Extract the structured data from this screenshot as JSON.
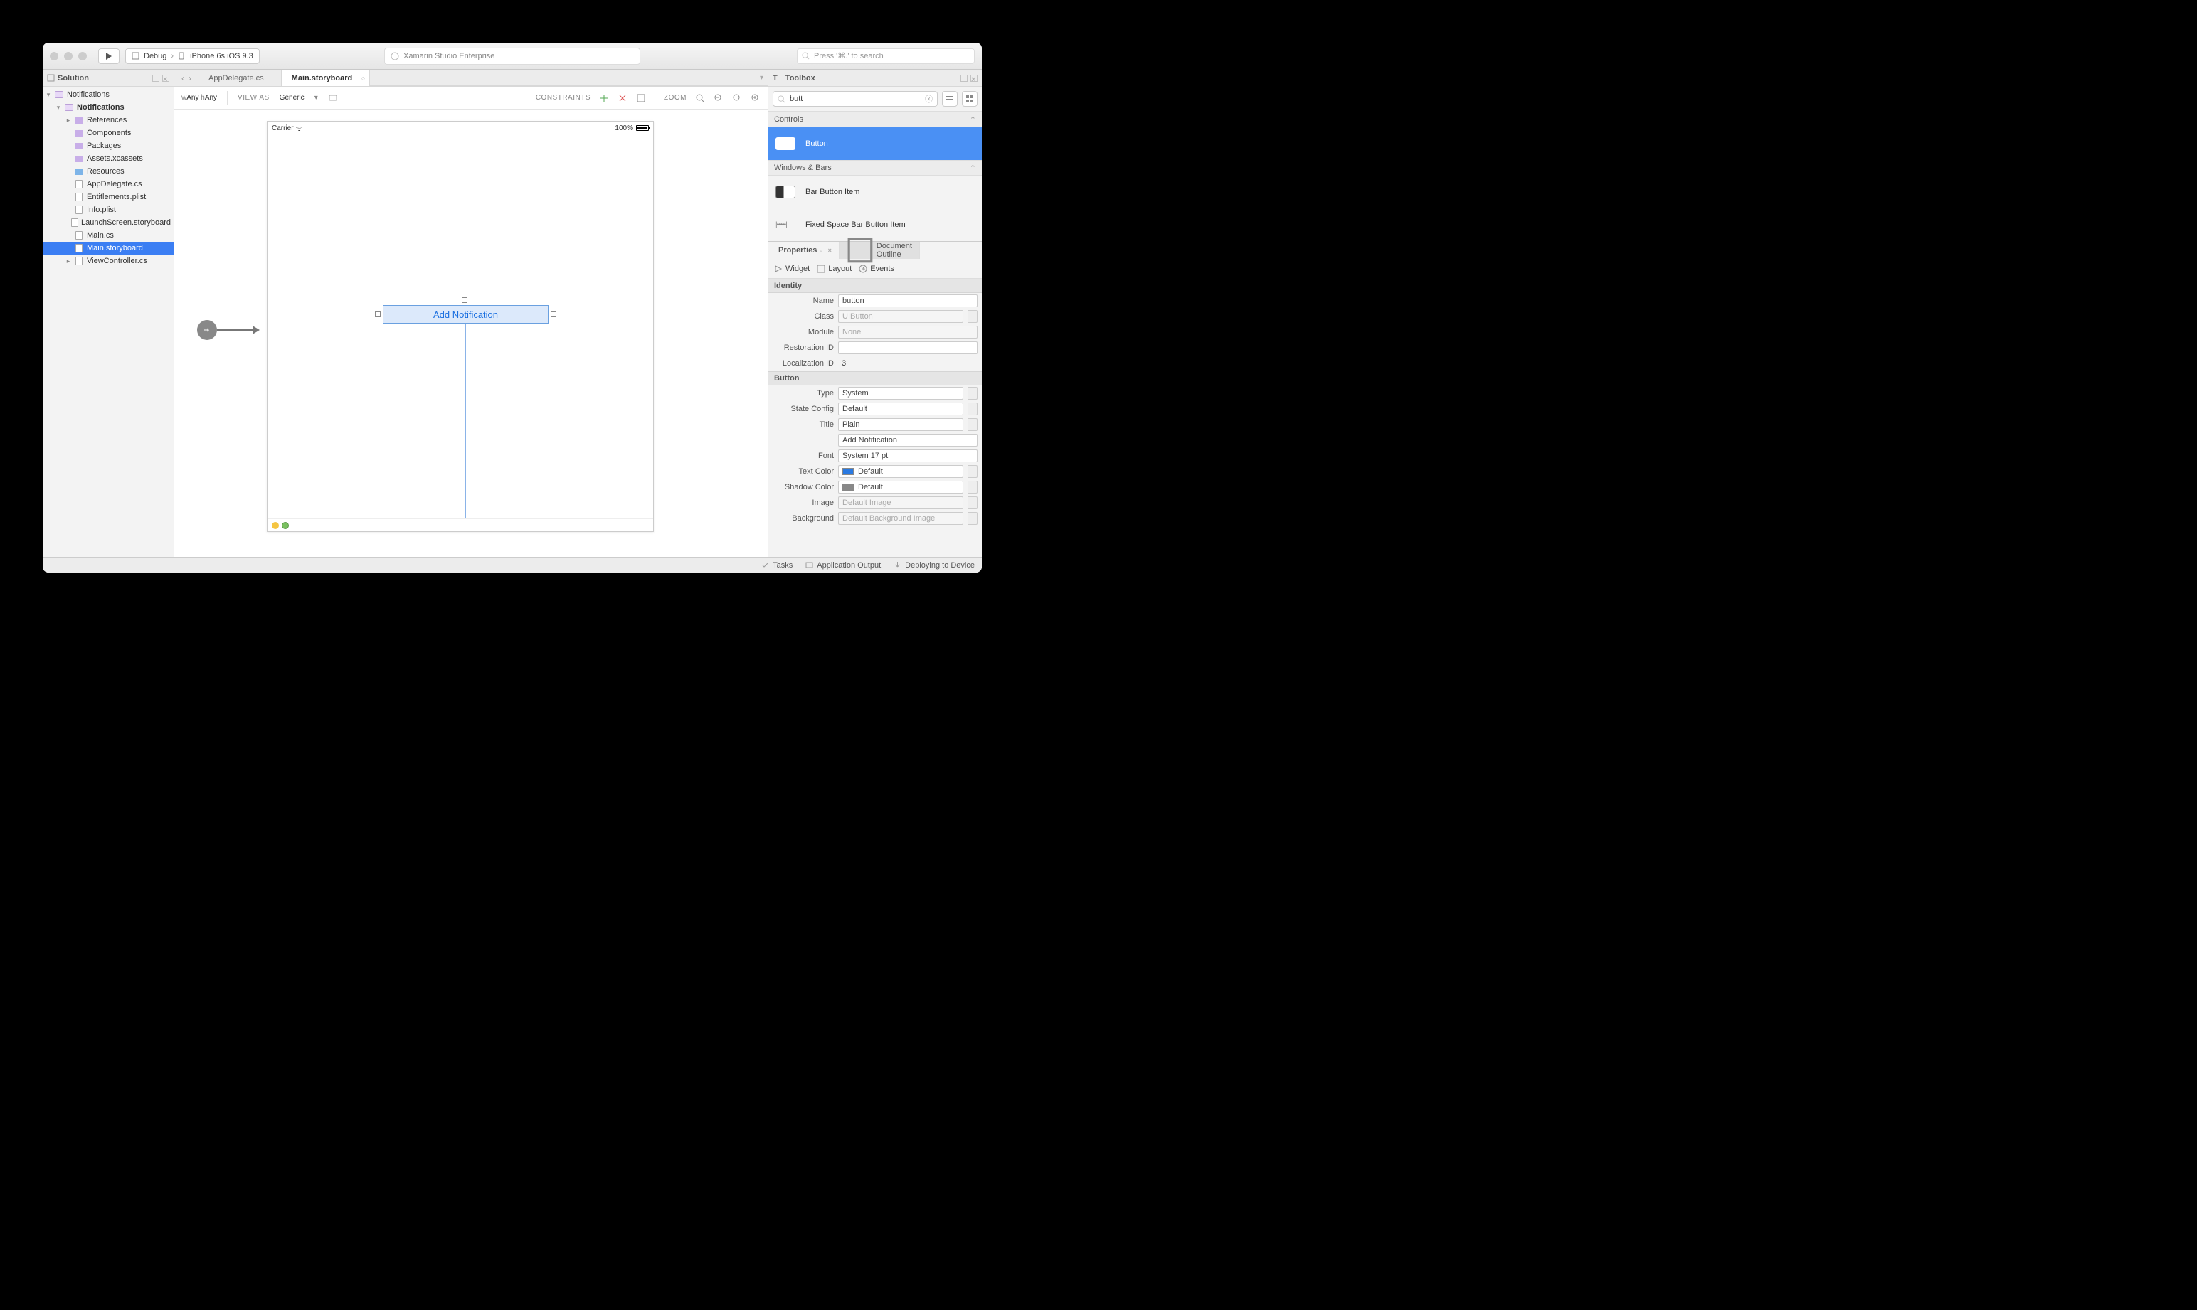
{
  "title": "Xamarin Studio Enterprise",
  "search_placeholder": "Press '⌘.' to search",
  "run_config": {
    "config": "Debug",
    "target": "iPhone 6s iOS 9.3"
  },
  "solution_pad": {
    "title": "Solution",
    "root": "Notifications",
    "project": "Notifications",
    "items": [
      {
        "label": "References",
        "icon": "folder-purple",
        "disc": "▸"
      },
      {
        "label": "Components",
        "icon": "folder-purple"
      },
      {
        "label": "Packages",
        "icon": "folder-purple"
      },
      {
        "label": "Assets.xcassets",
        "icon": "folder-purple"
      },
      {
        "label": "Resources",
        "icon": "folder-blue"
      },
      {
        "label": "AppDelegate.cs",
        "icon": "file"
      },
      {
        "label": "Entitlements.plist",
        "icon": "file"
      },
      {
        "label": "Info.plist",
        "icon": "file"
      },
      {
        "label": "LaunchScreen.storyboard",
        "icon": "file"
      },
      {
        "label": "Main.cs",
        "icon": "file"
      },
      {
        "label": "Main.storyboard",
        "icon": "file",
        "selected": true
      },
      {
        "label": "ViewController.cs",
        "icon": "file",
        "disc": "▸"
      }
    ]
  },
  "tabs": [
    {
      "label": "AppDelegate.cs",
      "active": false
    },
    {
      "label": "Main.storyboard",
      "active": true
    }
  ],
  "designer": {
    "sizeclass_w": "Any",
    "sizeclass_h": "Any",
    "view_as_label": "VIEW AS",
    "view_as": "Generic",
    "constraints_label": "CONSTRAINTS",
    "zoom_label": "ZOOM",
    "carrier": "Carrier",
    "battery_pct": "100%",
    "button_title": "Add Notification"
  },
  "toolbox": {
    "title": "Toolbox",
    "search": "butt",
    "sections": [
      {
        "name": "Controls",
        "items": [
          {
            "label": "Button",
            "selected": true,
            "thumb": "rect"
          }
        ]
      },
      {
        "name": "Windows & Bars",
        "items": [
          {
            "label": "Bar Button Item",
            "thumb": "barb"
          },
          {
            "label": "Fixed Space Bar Button Item",
            "thumb": "spacer"
          }
        ]
      }
    ]
  },
  "properties": {
    "tabs": {
      "properties": "Properties",
      "outline": "Document Outline"
    },
    "subtabs": {
      "widget": "Widget",
      "layout": "Layout",
      "events": "Events"
    },
    "identity_label": "Identity",
    "button_label": "Button",
    "fields": {
      "Name": "button",
      "Class": "UIButton",
      "Module": "None",
      "Restoration ID": "",
      "Localization ID": "3",
      "Type": "System",
      "State Config": "Default",
      "Title": "Plain",
      "Title_value": "Add Notification",
      "Font": "System 17 pt",
      "Text Color": "Default",
      "Shadow Color": "Default",
      "Image": "Default Image",
      "Background": "Default Background Image"
    }
  },
  "statusbar": {
    "tasks": "Tasks",
    "output": "Application Output",
    "deploy": "Deploying to Device"
  }
}
